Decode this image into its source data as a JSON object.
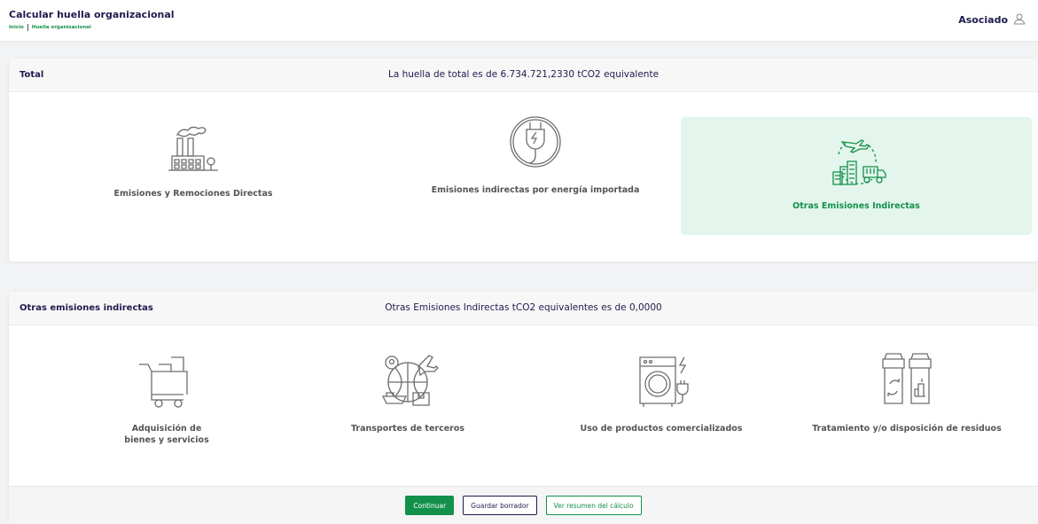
{
  "header": {
    "title": "Calcular huella organizacional",
    "breadcrumbs": [
      "Inicio",
      "Huella organizacional"
    ],
    "user_label": "Asociado",
    "user_icon": "user-icon"
  },
  "total": {
    "label": "Total",
    "summary": "La huella de total es de 6.734.721,2330 tCO2 equivalente",
    "tiles": [
      {
        "label": "Emisiones y Remociones Directas",
        "icon": "factory-icon",
        "active": false
      },
      {
        "label": "Emisiones indirectas por energía importada",
        "icon": "power-plug-icon",
        "active": false
      },
      {
        "label": "Otras Emisiones Indirectas",
        "icon": "transport-buildings-icon",
        "active": true
      }
    ]
  },
  "otras": {
    "label": "Otras emisiones indirectas",
    "summary": "Otras Emisiones Indirectas tCO2 equivalentes es de 0,0000",
    "tiles": [
      {
        "label_line1": "Adquisición de",
        "label_line2": "bienes y servicios",
        "icon": "shopping-cart-icon"
      },
      {
        "label": "Transportes de terceros",
        "icon": "global-transport-icon"
      },
      {
        "label": "Uso de productos comercializados",
        "icon": "washing-machine-icon"
      },
      {
        "label": "Tratamiento y/o disposición de residuos",
        "icon": "recycling-bins-icon"
      }
    ]
  },
  "actions": {
    "continue": "Continuar",
    "save_draft": "Guardar borrador",
    "view_summary": "Ver resumen del cálculo"
  },
  "colors": {
    "primary_green": "#13914b",
    "navy": "#1e1b4e",
    "active_tile_bg": "#e3f5ec"
  }
}
